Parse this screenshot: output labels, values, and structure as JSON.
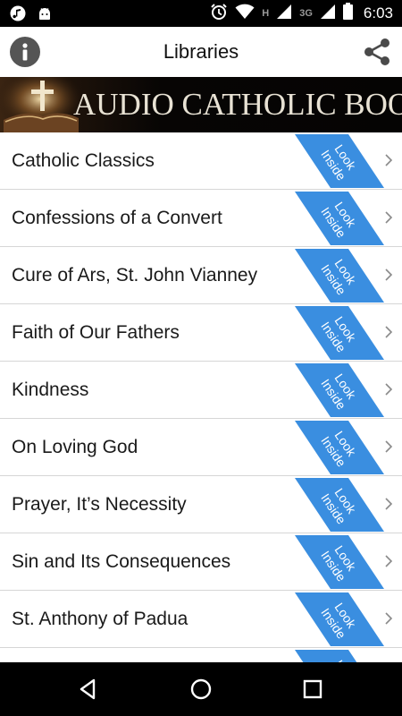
{
  "status_bar": {
    "time": "6:03",
    "network_h": "H",
    "network_3g": "3G",
    "left_icons": [
      "music-note-icon",
      "android-icon"
    ],
    "right_icons": [
      "alarm-icon",
      "wifi-icon",
      "signal-icon",
      "battery-icon"
    ]
  },
  "toolbar": {
    "title": "Libraries",
    "info_icon": "info-icon",
    "share_icon": "share-icon"
  },
  "banner": {
    "text": "AUDIO CATHOLIC BOOKS"
  },
  "library": {
    "ribbon_line1": "Look",
    "ribbon_line2": "Inside",
    "ribbon_color": "#3a8ee0",
    "items": [
      {
        "label": "Catholic Classics"
      },
      {
        "label": "Confessions of a Convert"
      },
      {
        "label": "Cure of Ars, St. John Vianney"
      },
      {
        "label": "Faith of Our Fathers"
      },
      {
        "label": "Kindness"
      },
      {
        "label": "On Loving God"
      },
      {
        "label": "Prayer, It’s Necessity"
      },
      {
        "label": "Sin and Its Consequences"
      },
      {
        "label": "St. Anthony of Padua"
      },
      {
        "label": ""
      }
    ]
  },
  "nav_bar": {
    "buttons": [
      "back-icon",
      "home-icon",
      "recents-icon"
    ]
  }
}
